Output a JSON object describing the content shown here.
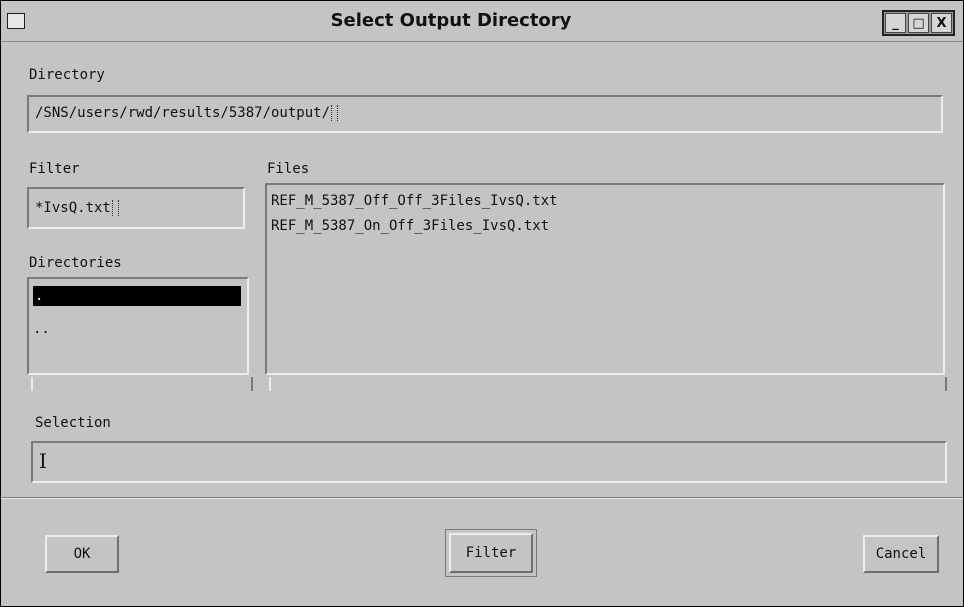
{
  "window": {
    "title": "Select Output Directory",
    "controls": {
      "minimize": "_",
      "maximize": "□",
      "close": "X"
    }
  },
  "directory": {
    "label": "Directory",
    "value": "/SNS/users/rwd/results/5387/output/"
  },
  "filter": {
    "label": "Filter",
    "value": "*IvsQ.txt"
  },
  "directories": {
    "label": "Directories",
    "items": [
      ".",
      ".."
    ],
    "selected_index": 0
  },
  "files": {
    "label": "Files",
    "items": [
      "REF_M_5387_Off_Off_3Files_IvsQ.txt",
      "REF_M_5387_On_Off_3Files_IvsQ.txt"
    ]
  },
  "selection": {
    "label": "Selection",
    "value": ""
  },
  "buttons": {
    "ok": "OK",
    "filter": "Filter",
    "cancel": "Cancel"
  },
  "colors": {
    "background": "#c4c4c4",
    "selected_bg": "#000000",
    "selected_fg": "#ffffff"
  }
}
